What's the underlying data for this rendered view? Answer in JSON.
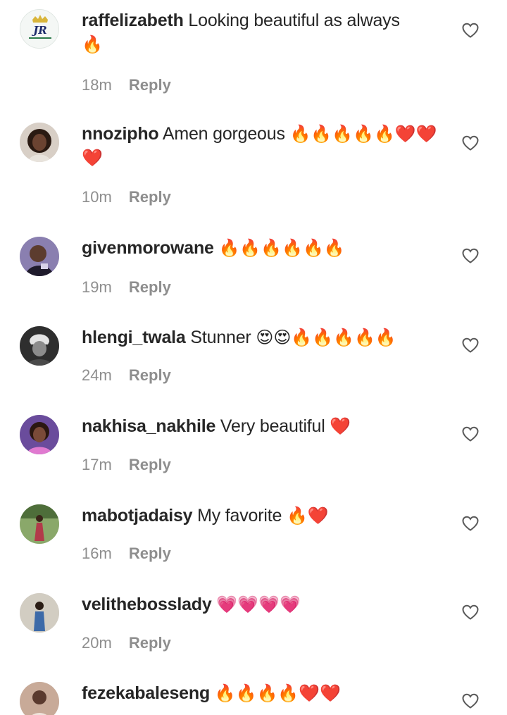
{
  "comments": [
    {
      "username": "raffelizabeth",
      "text": "Looking beautiful as always",
      "emoji": "🔥",
      "time": "18m",
      "reply": "Reply",
      "avatar_text": "JR",
      "avatar_colors": {
        "bg": "#f3f6f4",
        "fg": "#1c2a6b",
        "accent": "#d9b53a"
      }
    },
    {
      "username": "nnozipho",
      "text": "Amen gorgeous",
      "emoji": "🔥🔥🔥🔥🔥❤️❤️❤️",
      "time": "10m",
      "reply": "Reply",
      "avatar_colors": {
        "bg": "#c9b7a8",
        "fg": "#4a2e22",
        "accent": "#2a1a12"
      }
    },
    {
      "username": "givenmorowane",
      "text": "",
      "emoji": "🔥🔥🔥🔥🔥🔥",
      "time": "19m",
      "reply": "Reply",
      "avatar_colors": {
        "bg": "#6b5d8c",
        "fg": "#2b2440",
        "accent": "#c7bfe0"
      }
    },
    {
      "username": "hlengi_twala",
      "text": "Stunner",
      "emoji": "😍😍🔥🔥🔥🔥🔥",
      "time": "24m",
      "reply": "Reply",
      "avatar_colors": {
        "bg": "#3d3d3d",
        "fg": "#9a9a9a",
        "accent": "#e6e6e6"
      }
    },
    {
      "username": "nakhisa_nakhile",
      "text": "Very beautiful",
      "emoji": "❤️",
      "time": "17m",
      "reply": "Reply",
      "avatar_colors": {
        "bg": "#5a3a8a",
        "fg": "#e07ad0",
        "accent": "#3a1f1a"
      }
    },
    {
      "username": "mabotjadaisy",
      "text": "My favorite",
      "emoji": "🔥❤️",
      "time": "16m",
      "reply": "Reply",
      "avatar_colors": {
        "bg": "#6d8d4e",
        "fg": "#b23a4a",
        "accent": "#2e4a22"
      }
    },
    {
      "username": "velithebosslady",
      "text": "",
      "emoji": "💗💗💗💗",
      "time": "20m",
      "reply": "Reply",
      "avatar_colors": {
        "bg": "#c9c4b8",
        "fg": "#3c6aa8",
        "accent": "#2a1d15"
      }
    },
    {
      "username": "fezekabaleseng",
      "text": "",
      "emoji": "🔥🔥🔥🔥❤️❤️",
      "time": "",
      "reply": "",
      "avatar_colors": {
        "bg": "#b89a8a",
        "fg": "#5a3a2e",
        "accent": "#f0e4dc"
      }
    }
  ],
  "icons": {
    "like": "heart-outline-icon"
  },
  "colors": {
    "text": "#262626",
    "meta": "#8e8e8e",
    "background": "#ffffff"
  }
}
